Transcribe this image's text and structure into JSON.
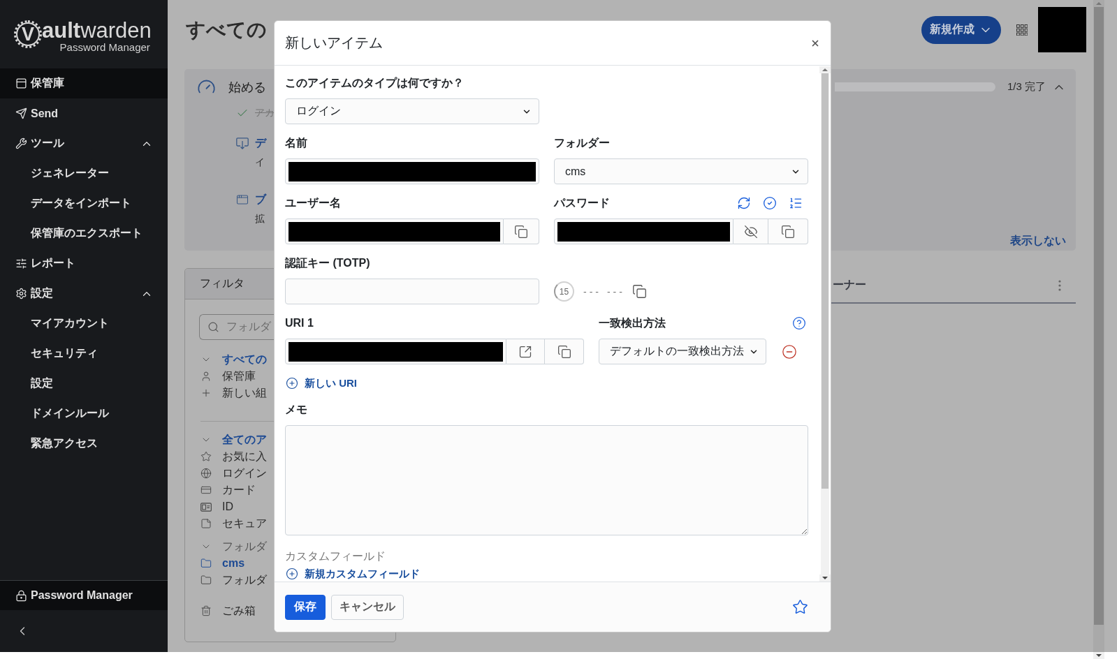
{
  "sidebar": {
    "logo": {
      "letter": "V",
      "wordmark": "**ault**warden",
      "subtitle": "Password Manager"
    },
    "items": [
      {
        "label": "保管庫",
        "selected": true
      },
      {
        "label": "Send",
        "selected": false
      },
      {
        "label": "ツール",
        "selected": false,
        "expanded": true,
        "children": [
          {
            "label": "ジェネレーター",
            "selected": false
          },
          {
            "label": "データをインポート",
            "selected": false
          },
          {
            "label": "保管庫のエクスポート",
            "selected": false
          }
        ]
      },
      {
        "label": "レポート",
        "selected": false
      },
      {
        "label": "設定",
        "selected": false,
        "expanded": true,
        "children": [
          {
            "label": "マイアカウント",
            "selected": false
          },
          {
            "label": "セキュリティ",
            "selected": false
          },
          {
            "label": "設定",
            "selected": false
          },
          {
            "label": "ドメインルール",
            "selected": false
          },
          {
            "label": "緊急アクセス",
            "selected": false
          }
        ]
      }
    ],
    "footer_item": "Password Manager"
  },
  "header": {
    "title": "すべての",
    "new_button": "新規作成",
    "avatar_redacted": true
  },
  "getting_started": {
    "title": "始める",
    "progress": "1/3 完了",
    "expanded": true,
    "steps": [
      {
        "title": "アカ",
        "done": true
      },
      {
        "title": "デ",
        "description": "イ",
        "done": false
      },
      {
        "title": "ブ",
        "description": "拡",
        "done": false
      }
    ],
    "hide_link": "表示しない"
  },
  "filter": {
    "title": "フィルタ",
    "search": {
      "placeholder": "フォルダ"
    },
    "sections": [
      {
        "label": "すべての",
        "selected": true,
        "expanded": true,
        "items": [
          {
            "label": "保管庫",
            "selected": false
          },
          {
            "label": "新しい組",
            "selected": false
          }
        ]
      },
      {
        "label": "全てのア",
        "selected": true,
        "expanded": true,
        "items": [
          {
            "label": "お気に入",
            "selected": false
          },
          {
            "label": "ログイン",
            "selected": false
          },
          {
            "label": "カード",
            "selected": false
          },
          {
            "label": "ID",
            "selected": false
          },
          {
            "label": "セキュア",
            "selected": false
          }
        ]
      },
      {
        "label": "フォルダ",
        "selected": false,
        "expanded": true,
        "items": [
          {
            "label": "cms",
            "selected": true
          },
          {
            "label": "フォルダ",
            "selected": false
          }
        ]
      }
    ],
    "trash": "ごみ箱"
  },
  "table": {
    "columns": [
      "ーナー"
    ]
  },
  "dialog": {
    "title": "新しいアイテム",
    "type": {
      "label": "このアイテムのタイプは何ですか？",
      "value": "ログイン"
    },
    "name": {
      "label": "名前",
      "redacted": true
    },
    "folder": {
      "label": "フォルダー",
      "value": "cms"
    },
    "username": {
      "label": "ユーザー名",
      "redacted": true
    },
    "password": {
      "label": "パスワード",
      "redacted": true,
      "visible": false
    },
    "totp": {
      "label": "認証キー (TOTP)",
      "countdown": "15",
      "code": "--- ---"
    },
    "uris": [
      {
        "label": "URI 1",
        "redacted": true,
        "match_label": "一致検出方法",
        "match_value": "デフォルトの一致検出方法"
      }
    ],
    "new_uri": "新しい URI",
    "notes": {
      "label": "メモ"
    },
    "custom_fields": {
      "heading": "カスタムフィールド",
      "add_link": "新規カスタムフィールド"
    },
    "buttons": [
      {
        "label": "保存",
        "kind": "primary"
      },
      {
        "label": "キャンセル",
        "kind": "secondary"
      }
    ],
    "favorite": false
  }
}
